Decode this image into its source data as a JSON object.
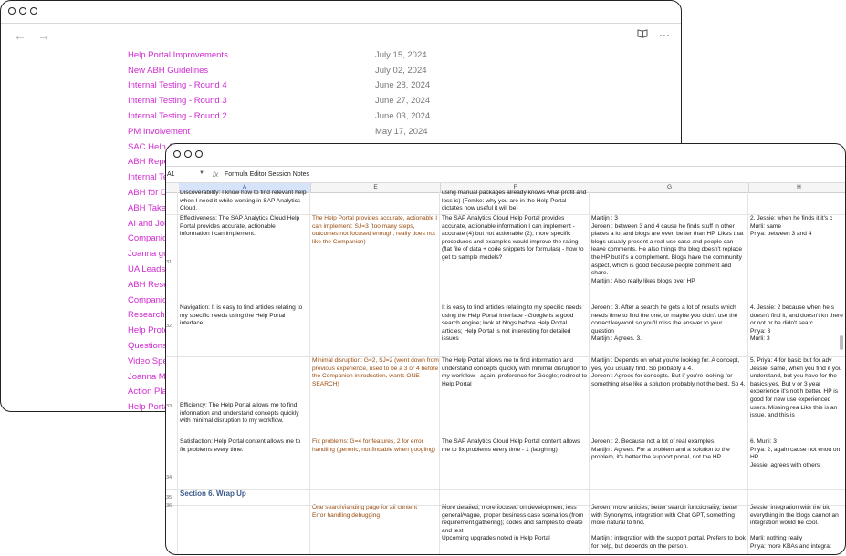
{
  "back_window": {
    "nav": {
      "back_glyph": "←",
      "forward_glyph": "→"
    },
    "top_right": {
      "book_icon": "book-icon",
      "more_glyph": "···"
    },
    "documents": [
      {
        "title": "Help Portal Improvements",
        "date": "July 15, 2024"
      },
      {
        "title": "New ABH Guidelines",
        "date": "July 02, 2024"
      },
      {
        "title": "Internal Testing - Round 4",
        "date": "June 28, 2024"
      },
      {
        "title": "Internal Testing - Round 3",
        "date": "June 27, 2024"
      },
      {
        "title": "Internal Testing - Round 2",
        "date": "June 03, 2024"
      },
      {
        "title": "PM Involvement",
        "date": "May 17, 2024"
      },
      {
        "title": "SAC Help Access Point",
        "date": "May 07, 2024"
      },
      {
        "title": "ABH Repo",
        "date": ""
      },
      {
        "title": "Internal Te",
        "date": ""
      },
      {
        "title": "ABH for Da",
        "date": ""
      },
      {
        "title": "ABH Takes",
        "date": ""
      },
      {
        "title": "AI and Jou",
        "date": ""
      },
      {
        "title": "Companio",
        "date": ""
      },
      {
        "title": "Joanna go",
        "date": ""
      },
      {
        "title": "UA Leads",
        "date": ""
      },
      {
        "title": "ABH Rese",
        "date": ""
      },
      {
        "title": "Companio",
        "date": ""
      },
      {
        "title": "Research",
        "date": ""
      },
      {
        "title": "Help Proto",
        "date": ""
      },
      {
        "title": "Questions",
        "date": ""
      },
      {
        "title": "Video Spe",
        "date": ""
      },
      {
        "title": "Joanna Me",
        "date": ""
      },
      {
        "title": "Action Pla",
        "date": ""
      },
      {
        "title": "Help Porta",
        "date": ""
      }
    ]
  },
  "front_window": {
    "formula_bar": {
      "cell_ref": "A1",
      "fx": "fx",
      "value": "Formula Editor Session Notes"
    },
    "columns": [
      "A",
      "E",
      "F",
      "G",
      "H"
    ],
    "row_numbers": [
      "31",
      "32",
      "33",
      "34",
      "35",
      "36"
    ],
    "rows": [
      {
        "A": "Discoverability: I know how to find relevant help when I need it while working in SAP Analytics Cloud.",
        "E": "",
        "F": "using manual packages already knows what profit and loss is) (Femke: why you are in the Help Portal dictates how useful it will be)",
        "G": "",
        "H": ""
      },
      {
        "A": "Effectiveness: The SAP Analytics Cloud Help Portal provides accurate, actionable information I can implement.",
        "E": "The Help Portal provides accurate, actionable I can implement: SJ=3 (too many steps, outcomes not focused enough, really does not like the Companion)",
        "F": "The SAP Analytics Cloud Help Portal provides accurate, actionable information I can implement - accurate (4) but not actionable (2); more specific procedures and examples would improve the rating (flat file of data + code snippets for formulas) - how to get to sample models?",
        "G": "Martijn : 3\nJeroen : between 3 and 4 cause he finds stuff in other places a lot and blogs are even better than HP. Likes that blogs usually present a real use case and people can leave comments. He also things the blog doesn't replace the HP but it's a complement. Blogs have the community aspect, which is good because people comment and share.\nMartijn : Also really likes blogs over HP.",
        "H": "2. Jessie: when he finds it it's c\nMurli: same\nPriya: between 3 and 4"
      },
      {
        "A": "Navigation: It is easy to find articles relating to my specific needs using the Help Portal interface.",
        "E": "",
        "F": "It is easy to find articles relating to my specific needs using the Help Portal Interface - Google is a good search engine; look at blogs before Help Portal articles; Help Portal is not interesting for detailed issues",
        "G": "Jeroen : 3. After a search he gets a lot of results which needs time to find the one, or maybe you didn't use the correct keyword so you'll miss the answer to your question\nMartijn : Agrees. 3.",
        "H": "4. Jessie: 2 because when he s doesn't find it, and doesn't kn there or not or he didn't searc\nPriya: 3\nMurli: 3"
      },
      {
        "A": "Efficiency: The Help Portal allows me to find information and understand concepts quickly with minimal disruption to my workflow.",
        "E": "Minimal disruption: G=2, SJ=2 (went down from previous experience, used to be a 3 or 4 before the Companion introduction, wants ONE SEARCH)",
        "F": "The Help Portal allows me to find information and understand concepts quickly with minimal disruption to my workflow - again, preference for Google; redirect to Help Portal",
        "G": "Martijn : Depends on what you're looking for. A concept, yes, you usually find. So probably a 4.\nJeroen : Agrees for concepts. But if you're looking for something else like a solution probably not the best. So 4.",
        "H": "5. Priya: 4 for basic but for adv\nJessie: same, when you find it you understand, but you have for the basics yes. But v or 3 year experience it's not h better. HP is good for new use experienced users. Missing rea Like this is an issue, and this is"
      },
      {
        "A": "Satisfaction: Help Portal content allows me to fix problems every time.",
        "E": "Fix problems: G=4 for features, 2 for error handling (generic, not findable when googling)",
        "F": "The SAP Analytics Cloud Help Portal content allows me to fix problems every time - 1 (laughing)",
        "G": "Jeroen : 2. Because not a lot of real examples.\nMartijn : Agrees. For a problem and a solution to the problem, it's better the support portal, not the HP.",
        "H": "6. Murli: 3\nPriya: 2, again cause not enou on HP\nJessie: agrees with others"
      },
      {
        "A": "Section 6. Wrap Up",
        "E": "One search/landing page for all content\nError handling debugging",
        "F": "More detailed, more focused on development, less general/vague, proper business case scenarios (from requirement gathering); codes and samples to create and test\nUpcoming upgrades noted in Help Portal",
        "G": "Jeroen: more articles, better search functionality, better with Synonyms, integration with Chat GPT, something more natural to find.\n\nMartijn : integration with the support portal. Prefers to look for help, but depends on the person.",
        "H": "Jessie: integration with the blo everything in the blogs cannot an integration would be cool.\n\nMurli: nothing really\nPriya: more KBAs and integrat"
      }
    ],
    "colors": {
      "black_text": "#1a1a1a",
      "brown_text": "#9a4a0c",
      "link_pink": "#d02ad0",
      "section_blue": "#3b5a8a"
    }
  }
}
